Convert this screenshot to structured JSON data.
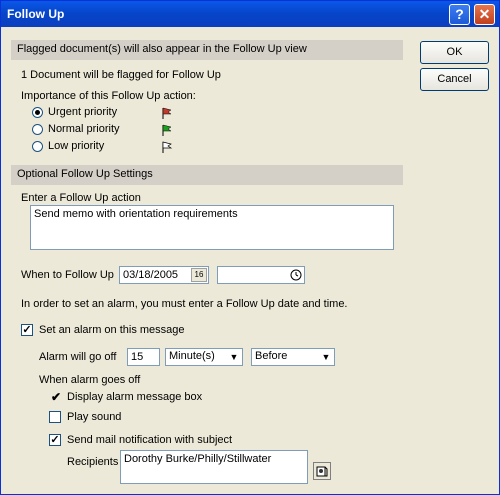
{
  "window": {
    "title": "Follow Up"
  },
  "titlebar": {
    "help_glyph": "?",
    "close_glyph": "✕"
  },
  "buttons": {
    "ok": "OK",
    "cancel": "Cancel"
  },
  "flagged": {
    "header": "Flagged document(s) will also appear in the Follow Up view",
    "count_text": "1 Document will be flagged for Follow Up",
    "importance_label": "Importance of this Follow Up action:",
    "priorities": [
      {
        "label": "Urgent priority",
        "checked": true,
        "flag_color": "#c0392b"
      },
      {
        "label": "Normal priority",
        "checked": false,
        "flag_color": "#1aa01a"
      },
      {
        "label": "Low priority",
        "checked": false,
        "flag_color": "#ffffff"
      }
    ]
  },
  "optional": {
    "header": "Optional Follow Up Settings",
    "action_label": "Enter a Follow Up action",
    "action_value": "Send memo with orientation requirements",
    "when_label": "When to Follow Up",
    "date_value": "03/18/2005",
    "date_icon": "16",
    "time_value": "",
    "alarm_note": "In order to set an alarm, you must enter a Follow Up date and time.",
    "set_alarm_label": "Set an alarm on this message",
    "set_alarm_checked": true,
    "alarm_go_off_label": "Alarm will go off",
    "alarm_amount": "15",
    "alarm_unit": "Minute(s)",
    "alarm_relation": "Before",
    "when_goes_off_label": "When alarm goes off",
    "display_box_label": "Display alarm message box",
    "play_sound_label": "Play sound",
    "send_mail_label": "Send mail notification with subject",
    "recipients_label": "Recipients",
    "recipients_value": "Dorothy Burke/Philly/Stillwater"
  }
}
